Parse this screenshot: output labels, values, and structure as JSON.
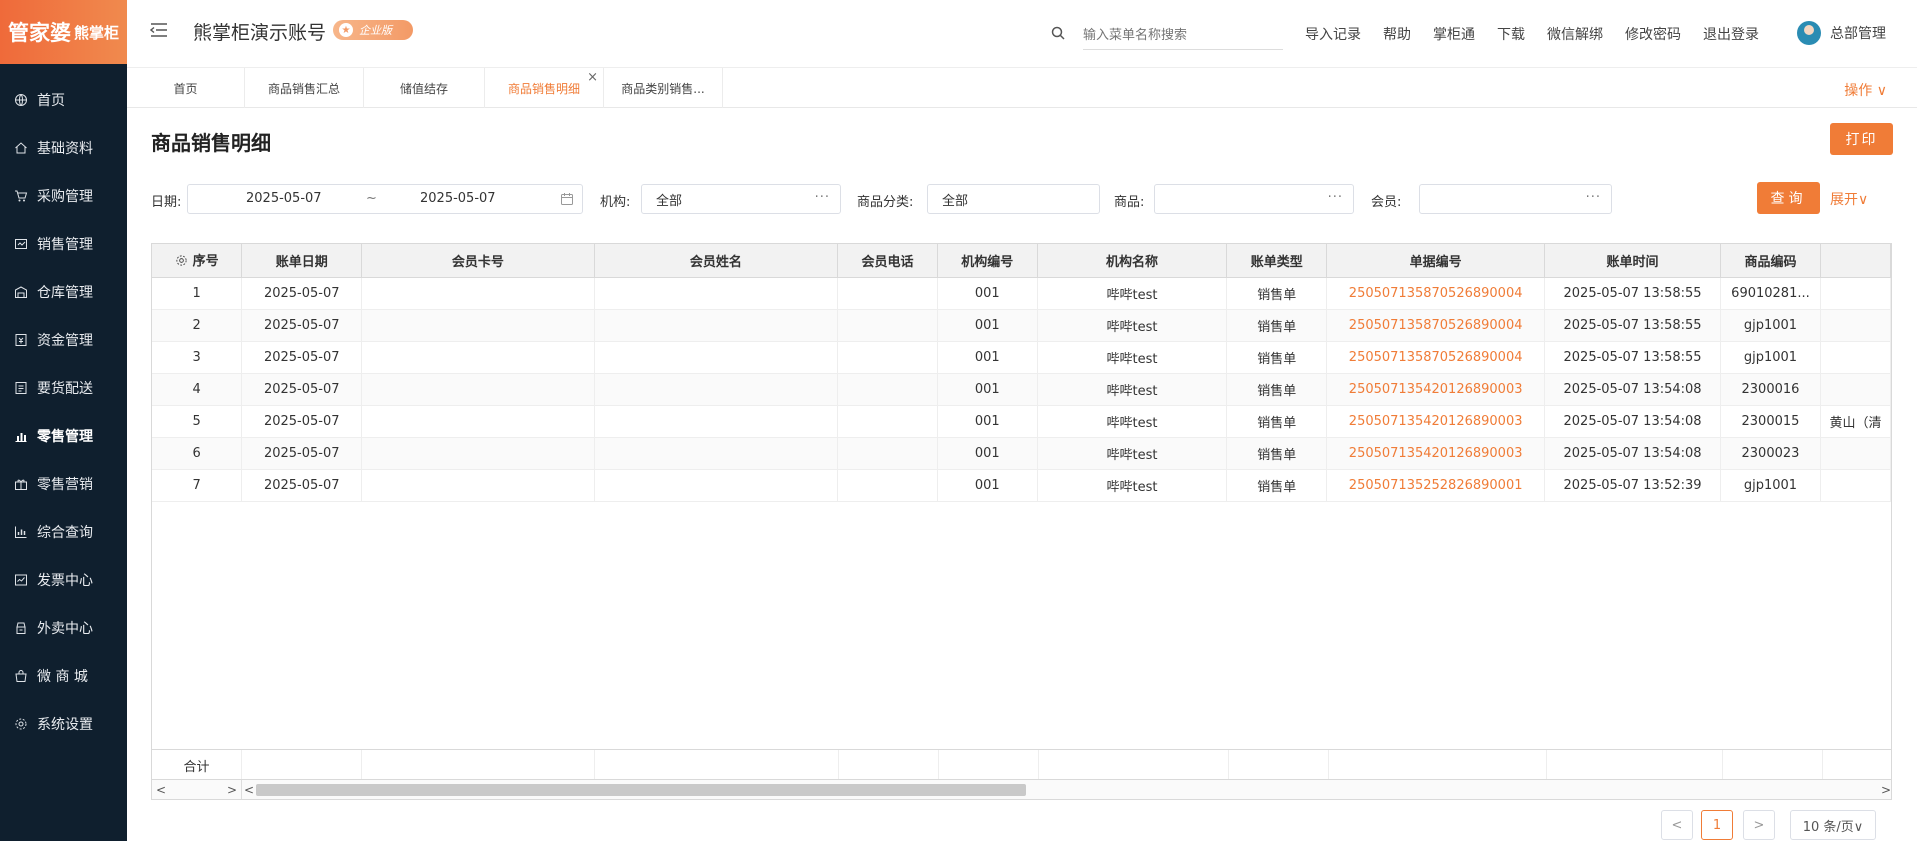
{
  "brand": {
    "name_main": "管家婆",
    "name_sub": "熊掌柜"
  },
  "sidebar": {
    "items": [
      {
        "label": "首页",
        "icon": "globe-icon"
      },
      {
        "label": "基础资料",
        "icon": "home-icon"
      },
      {
        "label": "采购管理",
        "icon": "cart-icon"
      },
      {
        "label": "销售管理",
        "icon": "sales-icon"
      },
      {
        "label": "仓库管理",
        "icon": "warehouse-icon"
      },
      {
        "label": "资金管理",
        "icon": "money-icon"
      },
      {
        "label": "要货配送",
        "icon": "delivery-icon"
      },
      {
        "label": "零售管理",
        "icon": "chart-icon"
      },
      {
        "label": "零售营销",
        "icon": "gift-icon"
      },
      {
        "label": "综合查询",
        "icon": "bar-chart-icon"
      },
      {
        "label": "发票中心",
        "icon": "invoice-icon"
      },
      {
        "label": "外卖中心",
        "icon": "takeout-icon"
      },
      {
        "label": "微 商 城",
        "icon": "shop-icon"
      },
      {
        "label": "系统设置",
        "icon": "gear-icon"
      }
    ],
    "active_index": 7
  },
  "header": {
    "account_title": "熊掌柜演示账号",
    "edition_badge": "企业版",
    "search_placeholder": "输入菜单名称搜索",
    "links": [
      "导入记录",
      "帮助",
      "掌柜通",
      "下载",
      "微信解绑",
      "修改密码",
      "退出登录"
    ],
    "user_name": "总部管理"
  },
  "tabs": {
    "items": [
      "首页",
      "商品销售汇总",
      "储值结存",
      "商品销售明细",
      "商品类别销售..."
    ],
    "active_index": 3,
    "close_symbol": "×",
    "ops_label": "操作 ∨"
  },
  "page": {
    "title": "商品销售明细",
    "print_label": "打印"
  },
  "filters": {
    "date_label": "日期:",
    "date_from": "2025-05-07",
    "date_sep": "~",
    "date_to": "2025-05-07",
    "org_label": "机构:",
    "org_value": "全部",
    "category_label": "商品分类:",
    "category_value": "全部",
    "goods_label": "商品:",
    "goods_value": "",
    "member_label": "会员:",
    "member_value": "",
    "more_symbol": "···",
    "query_label": "查询",
    "expand_label": "展开∨"
  },
  "table": {
    "columns": [
      "序号",
      "账单日期",
      "会员卡号",
      "会员姓名",
      "会员电话",
      "机构编号",
      "机构名称",
      "账单类型",
      "单据编号",
      "账单时间",
      "商品编码",
      ""
    ],
    "rows": [
      [
        "1",
        "2025-05-07",
        "",
        "",
        "",
        "001",
        "哔哔test",
        "销售单",
        "250507135870526890004",
        "2025-05-07 13:58:55",
        "69010281...",
        ""
      ],
      [
        "2",
        "2025-05-07",
        "",
        "",
        "",
        "001",
        "哔哔test",
        "销售单",
        "250507135870526890004",
        "2025-05-07 13:58:55",
        "gjp1001",
        ""
      ],
      [
        "3",
        "2025-05-07",
        "",
        "",
        "",
        "001",
        "哔哔test",
        "销售单",
        "250507135870526890004",
        "2025-05-07 13:58:55",
        "gjp1001",
        ""
      ],
      [
        "4",
        "2025-05-07",
        "",
        "",
        "",
        "001",
        "哔哔test",
        "销售单",
        "250507135420126890003",
        "2025-05-07 13:54:08",
        "2300016",
        ""
      ],
      [
        "5",
        "2025-05-07",
        "",
        "",
        "",
        "001",
        "哔哔test",
        "销售单",
        "250507135420126890003",
        "2025-05-07 13:54:08",
        "2300015",
        "黄山（清"
      ],
      [
        "6",
        "2025-05-07",
        "",
        "",
        "",
        "001",
        "哔哔test",
        "销售单",
        "250507135420126890003",
        "2025-05-07 13:54:08",
        "2300023",
        ""
      ],
      [
        "7",
        "2025-05-07",
        "",
        "",
        "",
        "001",
        "哔哔test",
        "销售单",
        "250507135252826890001",
        "2025-05-07 13:52:39",
        "gjp1001",
        ""
      ]
    ],
    "total_label": "合计"
  },
  "pagination": {
    "prev": "<",
    "current": "1",
    "next": ">",
    "page_size": "10 条/页∨"
  },
  "colors": {
    "accent": "#f07c37",
    "sidebar_bg": "#0f1f2e"
  }
}
